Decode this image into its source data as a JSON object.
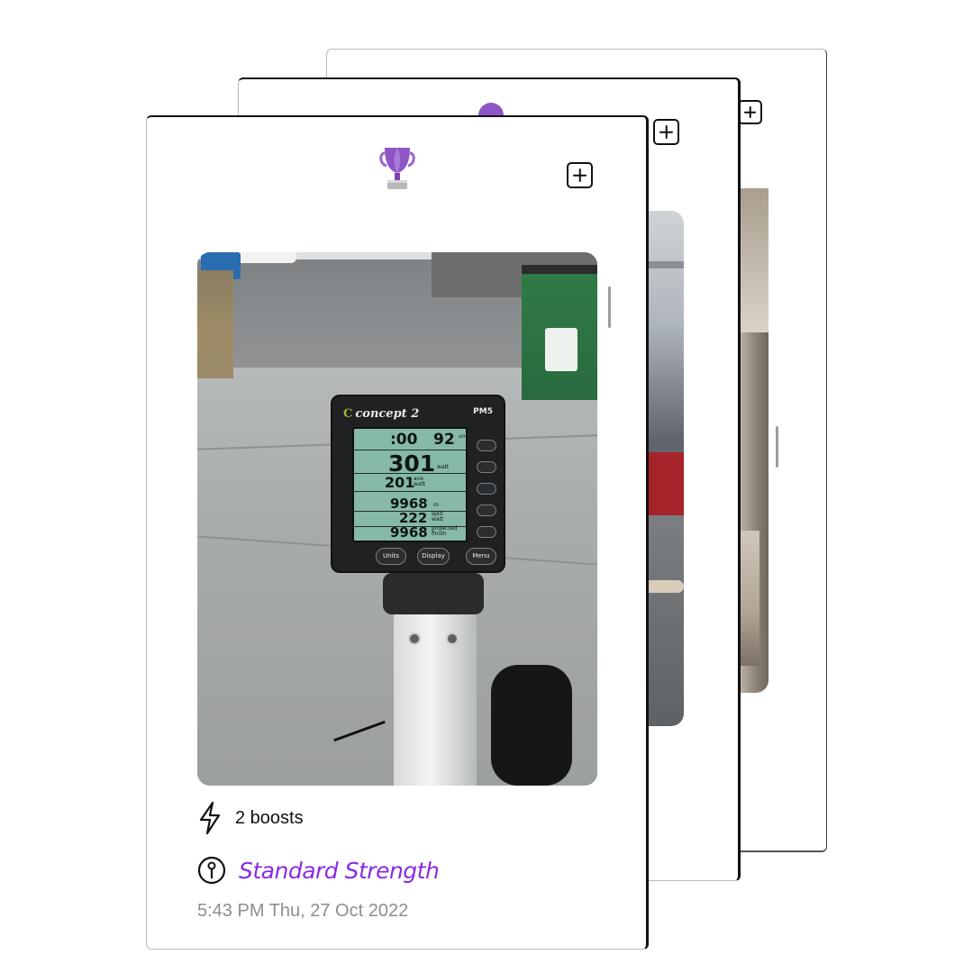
{
  "cards": {
    "front": {
      "boosts_label": "2 boosts",
      "program_name": "Standard Strength",
      "timestamp": "5:43 PM Thu, 27 Oct 2022",
      "monitor": {
        "brand": "concept 2",
        "model": "PM5",
        "time_value": ":00",
        "spm_value": "92",
        "spm_unit": "s/m",
        "watts_value": "301",
        "watts_unit": "watt",
        "avg_watts_value": "201",
        "avg_watts_unit": "ave watt",
        "distance_value": "9968",
        "distance_unit": "m",
        "split_value": "222",
        "split_unit": "split watt",
        "projected_value": "9968",
        "projected_unit": "projected finish",
        "buttons": [
          "Units",
          "Display",
          "Menu"
        ]
      }
    }
  },
  "colors": {
    "accent": "#8a2be2",
    "timestamp": "#8e8e8e",
    "trophy": "#8e55c7"
  },
  "icons": {
    "trophy": "trophy-icon",
    "add": "plus-square-icon",
    "boost": "lightning-bolt-icon",
    "program": "tag-icon"
  }
}
